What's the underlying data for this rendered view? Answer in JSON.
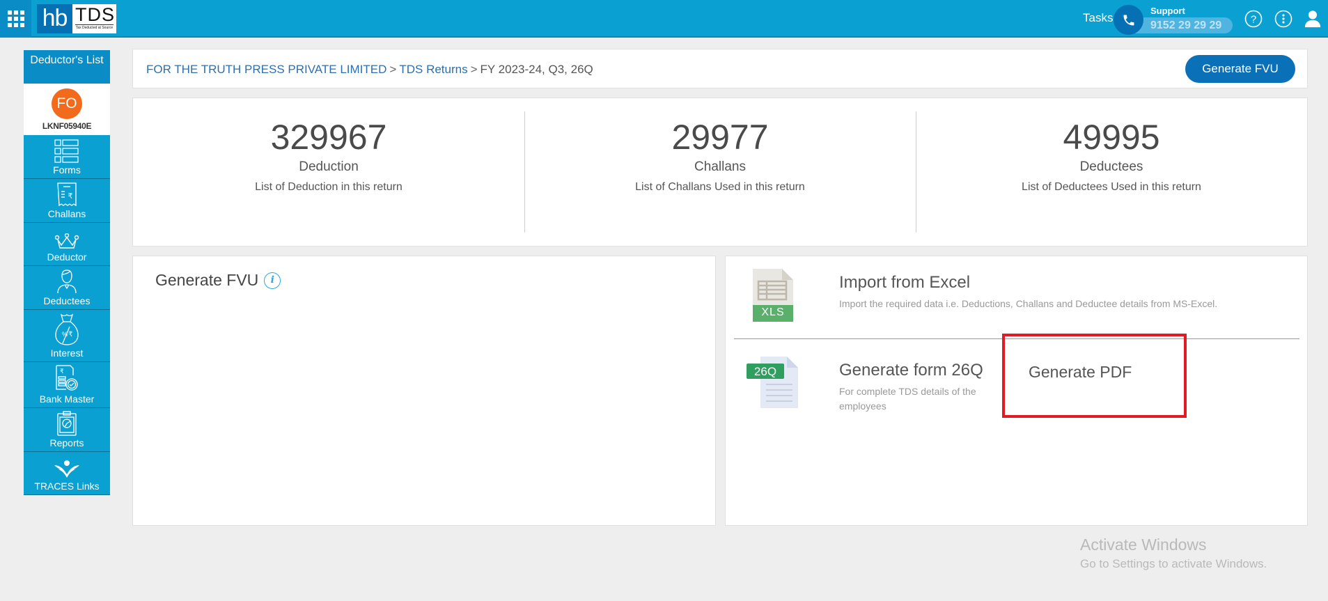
{
  "header": {
    "logo_hb": "hb",
    "logo_tds": "TDS",
    "logo_tagline": "Tax Deducted at Source",
    "tasks_label": "Tasks",
    "support_label": "Support",
    "support_number": "9152 29 29 29",
    "icons": [
      "apps-grid-icon",
      "phone-icon",
      "help-icon",
      "more-vertical-icon",
      "user-icon"
    ]
  },
  "sidebar": {
    "header": "Deductor's List",
    "avatar_initials": "FO",
    "user_code": "LKNF05940E",
    "items": [
      {
        "label": "Forms",
        "icon": "forms-icon"
      },
      {
        "label": "Challans",
        "icon": "challan-receipt-icon"
      },
      {
        "label": "Deductor",
        "icon": "crown-icon"
      },
      {
        "label": "Deductees",
        "icon": "person-icon"
      },
      {
        "label": "Interest",
        "icon": "money-bag-icon"
      },
      {
        "label": "Bank Master",
        "icon": "bank-icon"
      },
      {
        "label": "Reports",
        "icon": "clipboard-chart-icon"
      },
      {
        "label": "TRACES Links",
        "icon": "traces-logo-icon"
      }
    ]
  },
  "breadcrumb": {
    "items": [
      {
        "label": "FOR THE TRUTH PRESS PRIVATE LIMITED",
        "link": true
      },
      {
        "label": "TDS Returns",
        "link": true
      },
      {
        "label": "FY 2023-24, Q3, 26Q",
        "link": false
      }
    ],
    "separator": ">",
    "generate_fvu_button": "Generate FVU"
  },
  "stats": [
    {
      "value": "329967",
      "title": "Deduction",
      "subtitle": "List of Deduction in this return"
    },
    {
      "value": "29977",
      "title": "Challans",
      "subtitle": "List of Challans Used in this return"
    },
    {
      "value": "49995",
      "title": "Deductees",
      "subtitle": "List of Deductees Used in this return"
    }
  ],
  "fvu_panel": {
    "title": "Generate FVU",
    "info_icon": "i"
  },
  "actions": {
    "import_excel": {
      "badge": "XLS",
      "title": "Import from Excel",
      "description": "Import the required data i.e. Deductions, Challans and Deductee details from MS-Excel."
    },
    "generate_form": {
      "badge": "26Q",
      "title": "Generate form 26Q",
      "description": "For complete TDS details of the employees"
    },
    "generate_pdf": {
      "label": "Generate PDF"
    }
  },
  "watermark": {
    "title": "Activate Windows",
    "subtitle": "Go to Settings to activate Windows."
  },
  "colors": {
    "topbar": "#0aa0d2",
    "brand_dark": "#0670b5",
    "avatar": "#f26a1b",
    "highlight": "#e01b24",
    "xls_green": "#5aaf6b",
    "form_green": "#2f9e5e"
  }
}
